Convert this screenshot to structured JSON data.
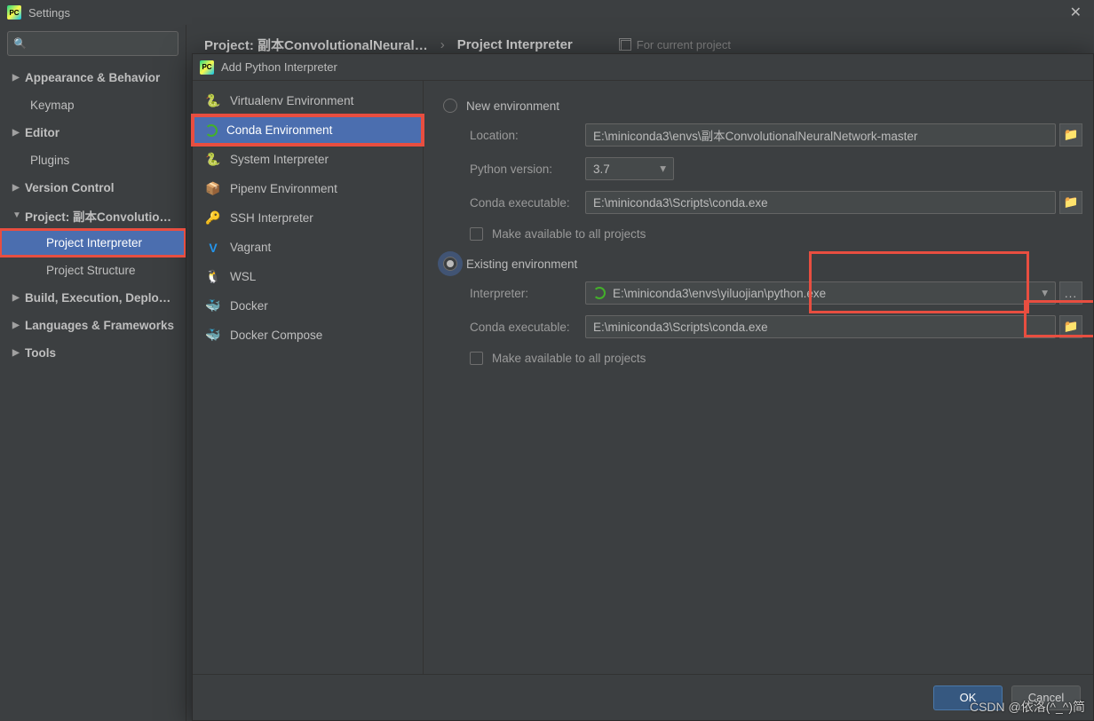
{
  "settings": {
    "title": "Settings",
    "close": "✕",
    "search_placeholder": "",
    "tree": {
      "appearance": "Appearance & Behavior",
      "keymap": "Keymap",
      "editor": "Editor",
      "plugins": "Plugins",
      "version_control": "Version Control",
      "project": "Project: 副本Convolutio…",
      "project_interpreter": "Project Interpreter",
      "project_structure": "Project Structure",
      "build": "Build, Execution, Deplo…",
      "languages": "Languages & Frameworks",
      "tools": "Tools"
    },
    "breadcrumb": {
      "a": "Project: 副本ConvolutionalNeural…",
      "b": "Project Interpreter",
      "hint": "For current project"
    },
    "back_buttons": {
      "ok": "OK",
      "cancel": "Cancel"
    }
  },
  "dialog": {
    "title": "Add Python Interpreter",
    "env_types": {
      "virtualenv": "Virtualenv Environment",
      "conda": "Conda Environment",
      "system": "System Interpreter",
      "pipenv": "Pipenv Environment",
      "ssh": "SSH Interpreter",
      "vagrant": "Vagrant",
      "wsl": "WSL",
      "docker": "Docker",
      "docker_compose": "Docker Compose"
    },
    "radio": {
      "new_env": "New environment",
      "existing": "Existing environment"
    },
    "labels": {
      "location": "Location:",
      "python_version": "Python version:",
      "conda_exe": "Conda executable:",
      "make_available": "Make available to all projects",
      "interpreter": "Interpreter:"
    },
    "values": {
      "location": "E:\\miniconda3\\envs\\副本ConvolutionalNeuralNetwork-master",
      "python_version": "3.7",
      "conda_exe": "E:\\miniconda3\\Scripts\\conda.exe",
      "interpreter": "E:\\miniconda3\\envs\\yiluojian\\python.exe",
      "conda_exe2": "E:\\miniconda3\\Scripts\\conda.exe"
    },
    "buttons": {
      "ok": "OK",
      "cancel": "Cancel"
    }
  },
  "watermark": "CSDN @依洛(^_^)简"
}
